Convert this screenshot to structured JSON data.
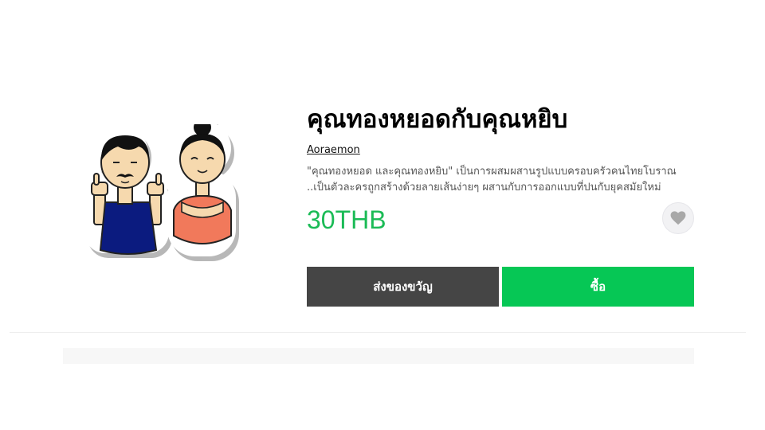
{
  "product": {
    "title": "คุณทองหยอดกับคุณหยิบ",
    "author": "Aoraemon",
    "description": "\"คุณทองหยอด และคุณทองหยิบ\" เป็นการผสมผสานรูปแบบครอบครัวคนไทยโบราณ ..เป็นตัวละครถูกสร้างด้วยลายเส้นง่ายๆ ผสานกับการออกแบบที่ปนกับยุคสมัยใหม่",
    "price": "30THB",
    "thumbnail_icon": "sticker-couple-image"
  },
  "actions": {
    "gift_label": "ส่งของขวัญ",
    "buy_label": "ซื้อ",
    "like_icon": "heart-icon"
  },
  "colors": {
    "price": "#1bbb56",
    "buy_button": "#06c755",
    "gift_button": "#454545",
    "like_button_bg": "#f2f2f4",
    "heart": "#a8a8a8"
  }
}
